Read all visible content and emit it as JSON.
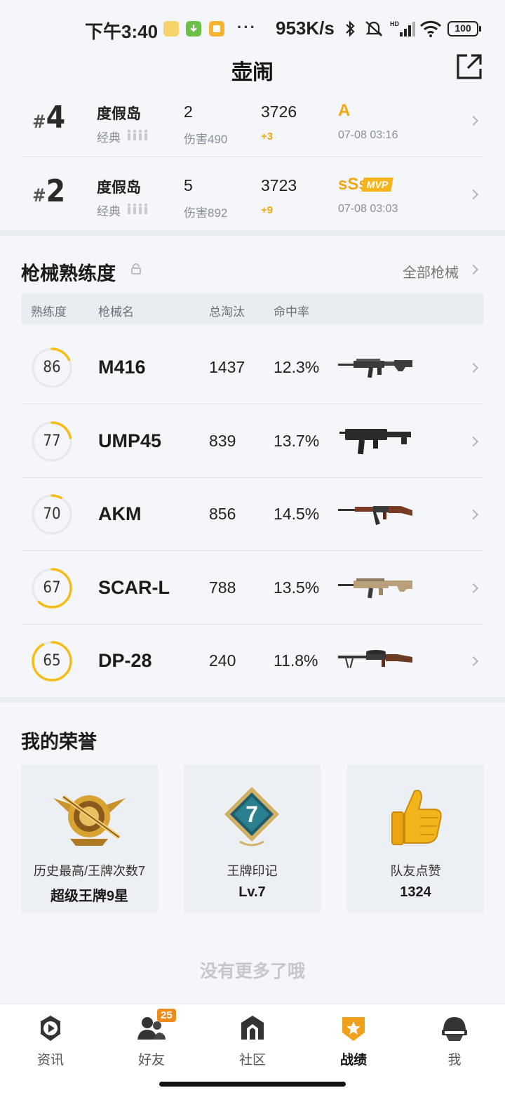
{
  "status_bar": {
    "time": "下午3:40",
    "net_speed": "953K/s",
    "battery": "100",
    "more": "···",
    "icons": [
      "calendar-app-icon",
      "download-icon",
      "notes-app-icon",
      "bluetooth-icon",
      "mute-icon",
      "hd-signal-icon",
      "wifi-icon",
      "battery-icon"
    ]
  },
  "header": {
    "title": "壶闹",
    "share_icon": "share-export-icon"
  },
  "matches": [
    {
      "rank_hash": "#",
      "rank": "4",
      "map": "度假岛",
      "mode": "经典",
      "kills": "2",
      "damage": "伤害490",
      "score": "3726",
      "score_delta": "+3",
      "grade": "A",
      "date": "07-08 03:16"
    },
    {
      "rank_hash": "#",
      "rank": "2",
      "map": "度假岛",
      "mode": "经典",
      "kills": "5",
      "damage": "伤害892",
      "score": "3723",
      "score_delta": "+9",
      "grade": "sSs",
      "mvp": "MVP",
      "date": "07-08 03:03"
    }
  ],
  "weapons_section": {
    "title": "枪械熟练度",
    "all_link": "全部枪械",
    "headers": [
      "熟练度",
      "枪械名",
      "总淘汰",
      "命中率"
    ],
    "rows": [
      {
        "mastery": "86",
        "mastery_progress": 0.18,
        "name": "M416",
        "kills": "1437",
        "accuracy": "12.3%",
        "image": "m416-rifle-image"
      },
      {
        "mastery": "77",
        "mastery_progress": 0.22,
        "name": "UMP45",
        "kills": "839",
        "accuracy": "13.7%",
        "image": "ump45-smg-image"
      },
      {
        "mastery": "70",
        "mastery_progress": 0.08,
        "name": "AKM",
        "kills": "856",
        "accuracy": "14.5%",
        "image": "akm-rifle-image"
      },
      {
        "mastery": "67",
        "mastery_progress": 0.62,
        "name": "SCAR-L",
        "kills": "788",
        "accuracy": "13.5%",
        "image": "scar-l-rifle-image"
      },
      {
        "mastery": "65",
        "mastery_progress": 0.92,
        "name": "DP-28",
        "kills": "240",
        "accuracy": "11.8%",
        "image": "dp28-lmg-image"
      }
    ]
  },
  "honors_section": {
    "title": "我的荣誉",
    "cards": [
      {
        "label": "历史最高/王牌次数7",
        "value": "超级王牌9星",
        "icon": "ace-emblem-icon"
      },
      {
        "label": "王牌印记",
        "value": "Lv.7",
        "emblem_number": "7",
        "icon": "ace-mark-icon"
      },
      {
        "label": "队友点赞",
        "value": "1324",
        "icon": "thumbs-up-icon"
      }
    ]
  },
  "footer_note": "没有更多了哦",
  "bottom_nav": [
    {
      "label": "资讯",
      "icon": "news-play-icon"
    },
    {
      "label": "好友",
      "icon": "friends-icon",
      "badge": "25"
    },
    {
      "label": "社区",
      "icon": "community-icon"
    },
    {
      "label": "战绩",
      "icon": "record-shield-icon",
      "active": true
    },
    {
      "label": "我",
      "icon": "profile-helmet-icon"
    }
  ],
  "colors": {
    "accent": "#f3a712",
    "ring_accent": "#f6bd16",
    "ring_track": "#e6e8ec",
    "background": "#f4f6f9"
  }
}
